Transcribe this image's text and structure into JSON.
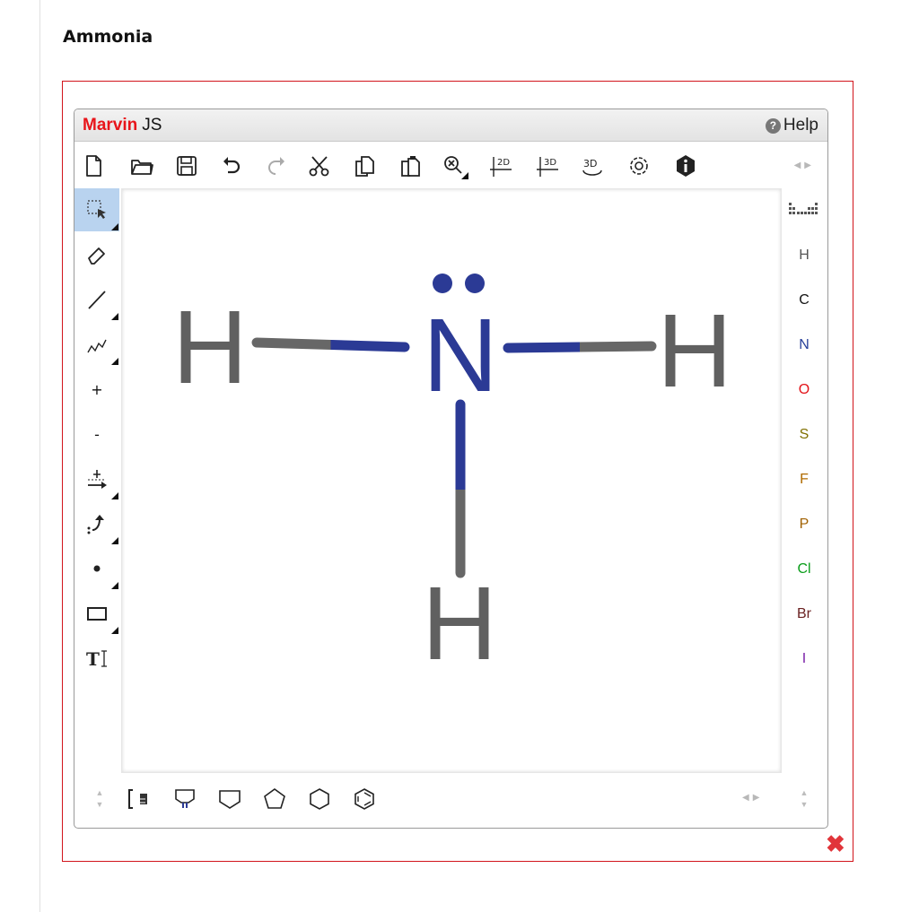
{
  "page": {
    "title": "Ammonia"
  },
  "editor": {
    "brand_red": "Marvin",
    "brand_rest": "JS",
    "help_label": "Help",
    "help_icon": "?",
    "accent_color": "#e8141a",
    "frame_color": "#d2141b",
    "toolbar_icons": [
      "new-document-icon",
      "open-folder-icon",
      "save-icon",
      "undo-icon",
      "redo-icon",
      "cut-icon",
      "copy-icon",
      "paste-icon",
      "zoom-icon",
      "clean-2d-icon",
      "clean-3d-icon",
      "rotate-3d-icon",
      "settings-gear-icon",
      "info-icon"
    ],
    "left_tools": {
      "charge_plus": "+",
      "charge_minus": "-"
    },
    "elements": [
      {
        "symbol": "H",
        "color": "#555555"
      },
      {
        "symbol": "C",
        "color": "#111111"
      },
      {
        "symbol": "N",
        "color": "#27409a"
      },
      {
        "symbol": "O",
        "color": "#e3141a"
      },
      {
        "symbol": "S",
        "color": "#807000"
      },
      {
        "symbol": "F",
        "color": "#b06b00"
      },
      {
        "symbol": "P",
        "color": "#a06000"
      },
      {
        "symbol": "Cl",
        "color": "#0a9d1a"
      },
      {
        "symbol": "Br",
        "color": "#6b2222"
      },
      {
        "symbol": "I",
        "color": "#7a1fa8"
      }
    ],
    "bottom_templates": [
      "bracket-template-icon",
      "cyclopropane-template-icon",
      "cyclobutane-template-icon",
      "cyclopentane-template-icon",
      "cyclohexane-template-icon",
      "benzene-template-icon"
    ]
  },
  "molecule": {
    "name": "Ammonia",
    "atoms": [
      {
        "symbol": "N",
        "color": "#2b3a95",
        "lone_pairs": 1
      },
      {
        "symbol": "H",
        "color": "#606060"
      },
      {
        "symbol": "H",
        "color": "#606060"
      },
      {
        "symbol": "H",
        "color": "#606060"
      }
    ],
    "bonds": [
      {
        "from": 0,
        "to": 1,
        "order": 1
      },
      {
        "from": 0,
        "to": 2,
        "order": 1
      },
      {
        "from": 0,
        "to": 3,
        "order": 1
      }
    ]
  },
  "close_icon": "✖"
}
